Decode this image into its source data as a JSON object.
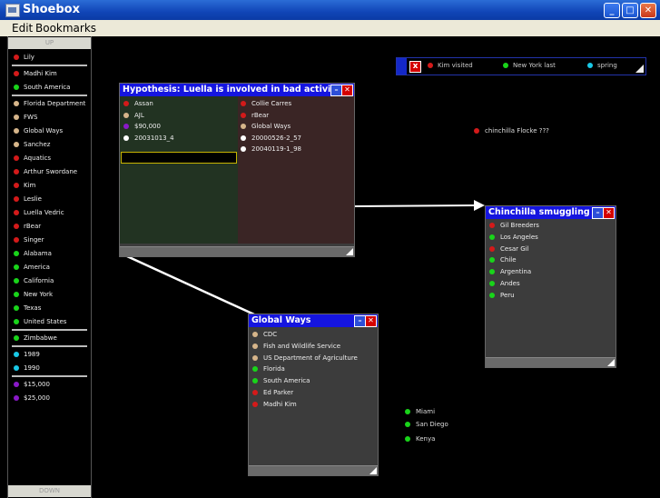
{
  "window": {
    "title": "Shoebox",
    "controls": [
      "_",
      "□",
      "✕"
    ]
  },
  "menu": {
    "items": [
      "Edit",
      "Bookmarks"
    ]
  },
  "colors": {
    "red": "#d41a1a",
    "tan": "#d6b58a",
    "green": "#19d41a",
    "cyan": "#19c8e6",
    "purple": "#8a19c8",
    "white": "#ffffff",
    "title_blue": "#1515e0"
  },
  "sidebar": {
    "up_label": "UP",
    "down_label": "DOWN",
    "groups": [
      [
        {
          "label": "Lily",
          "color": "red"
        }
      ],
      [
        {
          "label": "Madhi Kim",
          "color": "red"
        },
        {
          "label": "South America",
          "color": "green"
        }
      ],
      [
        {
          "label": "Florida Department",
          "color": "tan"
        },
        {
          "label": "FWS",
          "color": "tan"
        },
        {
          "label": "Global Ways",
          "color": "tan"
        },
        {
          "label": "Sanchez",
          "color": "tan"
        },
        {
          "label": "Aquatics",
          "color": "red"
        },
        {
          "label": "Arthur Swordane",
          "color": "red"
        },
        {
          "label": "Kim",
          "color": "red"
        },
        {
          "label": "Leslie",
          "color": "red"
        },
        {
          "label": "Luella Vedric",
          "color": "red"
        },
        {
          "label": "rBear",
          "color": "red"
        },
        {
          "label": "Singer",
          "color": "red"
        },
        {
          "label": "Alabama",
          "color": "green"
        },
        {
          "label": "America",
          "color": "green"
        },
        {
          "label": "California",
          "color": "green"
        },
        {
          "label": "New York",
          "color": "green"
        },
        {
          "label": "Texas",
          "color": "green"
        },
        {
          "label": "United States",
          "color": "green"
        }
      ],
      [
        {
          "label": "Zimbabwe",
          "color": "green"
        }
      ],
      [
        {
          "label": "1989",
          "color": "cyan"
        },
        {
          "label": "1990",
          "color": "cyan"
        }
      ],
      [
        {
          "label": "$15,000",
          "color": "purple"
        },
        {
          "label": "$25,000",
          "color": "purple"
        }
      ]
    ]
  },
  "legend": {
    "close": "x",
    "items": [
      {
        "label": "Kim  visited",
        "color": "red"
      },
      {
        "label": "New York  last",
        "color": "green"
      },
      {
        "label": "spring",
        "color": "cyan"
      }
    ]
  },
  "floating": [
    {
      "label": "chinchilla Flocke  ???",
      "color": "red"
    },
    {
      "label": "Miami",
      "color": "green"
    },
    {
      "label": "San Diego",
      "color": "green"
    },
    {
      "label": "Kenya",
      "color": "green"
    }
  ],
  "hypothesis": {
    "title": "Hypothesis: Luella is involved in bad activities",
    "left": [
      {
        "label": "Assan",
        "color": "red"
      },
      {
        "label": "AJL",
        "color": "tan"
      },
      {
        "label": "$90,000",
        "color": "purple"
      },
      {
        "label": "20031013_4",
        "color": "white"
      }
    ],
    "input_value": "",
    "right": [
      {
        "label": "Collie Carres",
        "color": "red"
      },
      {
        "label": "rBear",
        "color": "red"
      },
      {
        "label": "Global Ways",
        "color": "tan"
      },
      {
        "label": "20000526-2_57",
        "color": "white"
      },
      {
        "label": "20040119-1_98",
        "color": "white"
      }
    ]
  },
  "chinchilla": {
    "title": "Chinchilla smuggling",
    "items": [
      {
        "label": "Gil Breeders",
        "color": "red"
      },
      {
        "label": "Los Angeles",
        "color": "green"
      },
      {
        "label": "Cesar Gil",
        "color": "red"
      },
      {
        "label": "Chile",
        "color": "green"
      },
      {
        "label": "Argentina",
        "color": "green"
      },
      {
        "label": "Andes",
        "color": "green"
      },
      {
        "label": "Peru",
        "color": "green"
      }
    ]
  },
  "globalways": {
    "title": "Global Ways",
    "items": [
      {
        "label": "CDC",
        "color": "tan"
      },
      {
        "label": "Fish and Wildlife Service",
        "color": "tan"
      },
      {
        "label": "US Department of Agriculture",
        "color": "tan"
      },
      {
        "label": "Florida",
        "color": "green"
      },
      {
        "label": "South America",
        "color": "green"
      },
      {
        "label": "Ed Parker",
        "color": "red"
      },
      {
        "label": "Madhi Kim",
        "color": "red"
      }
    ]
  }
}
